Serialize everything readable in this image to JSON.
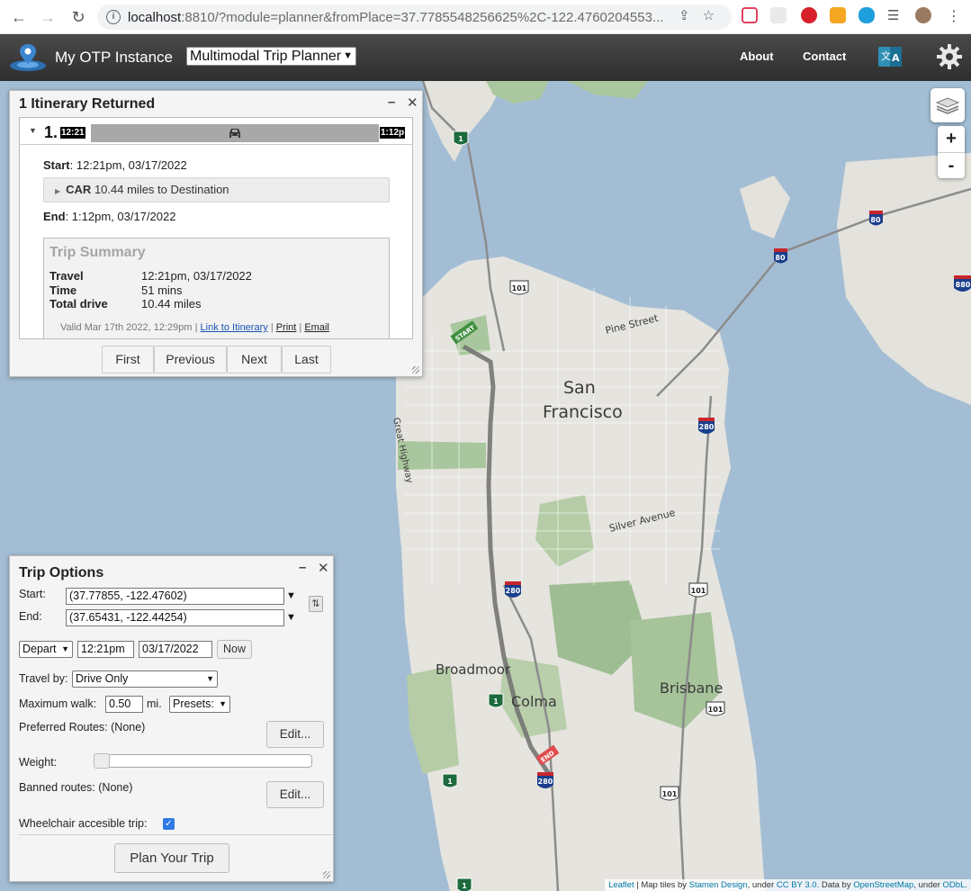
{
  "browser": {
    "url_host": "localhost",
    "url_rest": ":8810/?module=planner&fromPlace=37.7785548256625%2C-122.4760204553..."
  },
  "header": {
    "app_title": "My OTP Instance",
    "mode_select": "Multimodal Trip Planner",
    "about": "About",
    "contact": "Contact"
  },
  "itinerary": {
    "panel_title": "1 Itinerary Returned",
    "number": "1.",
    "start_tag": "12:21",
    "end_tag": "1:12p",
    "start_label": "Start",
    "start_value": ": 12:21pm, 03/17/2022",
    "leg_mode": "CAR",
    "leg_desc": "10.44 miles to Destination",
    "end_label": "End",
    "end_value": ": 1:12pm, 03/17/2022",
    "summary": {
      "title": "Trip Summary",
      "travel_label": "Travel",
      "travel_value": "12:21pm, 03/17/2022",
      "time_label": "Time",
      "time_value": "51 mins",
      "drive_label": "Total drive",
      "drive_value": "10.44 miles",
      "valid": "Valid Mar 17th 2022, 12:29pm |",
      "link_itinerary": "Link to Itinerary",
      "sep": "|",
      "print": "Print",
      "email": "Email"
    },
    "pager": {
      "first": "First",
      "previous": "Previous",
      "next": "Next",
      "last": "Last"
    }
  },
  "trip_options": {
    "title": "Trip Options",
    "start_label": "Start:",
    "start_value": "(37.77855, -122.47602)",
    "end_label": "End:",
    "end_value": "(37.65431, -122.44254)",
    "depart": "Depart",
    "time": "12:21pm",
    "date": "03/17/2022",
    "now": "Now",
    "travel_by_label": "Travel by:",
    "travel_by": "Drive Only",
    "max_walk_label": "Maximum walk:",
    "max_walk": "0.50",
    "max_walk_unit": "mi.",
    "presets": "Presets:",
    "preferred_routes": "Preferred Routes: (None)",
    "edit": "Edit...",
    "weight_label": "Weight:",
    "weight_level": 0,
    "banned_routes": "Banned routes: (None)",
    "wheelchair_label": "Wheelchair accesible trip:",
    "wheelchair_checked": true,
    "plan": "Plan Your Trip"
  },
  "map": {
    "labels": {
      "sf1": "San",
      "sf2": "Francisco",
      "broadmoor": "Broadmoor",
      "colma": "Colma",
      "brisbane": "Brisbane",
      "pine": "Pine Street",
      "silver": "Silver Avenue",
      "great_highway": "Great Highway",
      "start_flag": "START",
      "end_flag": "END"
    },
    "shields": {
      "us101": "101",
      "i280": "280",
      "i80": "80",
      "i880": "880",
      "ca1": "1"
    },
    "zoom_in": "+",
    "zoom_out": "-",
    "attribution": {
      "leaflet": "Leaflet",
      "text1": "| Map tiles by",
      "stamen": "Stamen Design",
      "text2": ", under",
      "cc": "CC BY 3.0",
      "text3": ". Data by",
      "osm": "OpenStreetMap",
      "text4": ", under",
      "odbl": "ODbL"
    }
  },
  "colors": {
    "water": "#a3bed4",
    "land": "#e6e4df",
    "park": "#a9c79e",
    "route": "#7a7a7a",
    "shield_interstate": "#1a3e8c",
    "shield_ca": "#1d6b3d"
  }
}
